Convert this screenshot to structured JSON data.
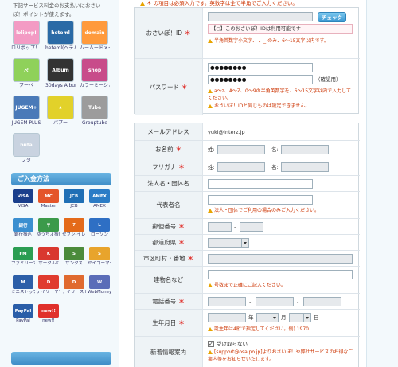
{
  "sidebar": {
    "note": "下記サービス料金のお支払いにおさいぽ！ポイントが使えます。",
    "services": [
      {
        "label": "ロリポップ！レンタルサーバー",
        "icon": "lolipop-icon",
        "color": "#f39bc4",
        "tile": "lolipop!"
      },
      {
        "label": "heteml(ヘテムル)",
        "icon": "heteml-icon",
        "color": "#2a6aa6",
        "tile": "heteml"
      },
      {
        "label": "ムームードメイン",
        "icon": "muumuu-domain-icon",
        "color": "#ff9a3c",
        "tile": "domain"
      },
      {
        "label": "ブーペ",
        "icon": "petit-icon",
        "color": "#8fd15a",
        "tile": "ペ"
      },
      {
        "label": "30days Album",
        "icon": "30days-album-icon",
        "color": "#333333",
        "tile": "Album"
      },
      {
        "label": "カラーミーショップ",
        "icon": "colorme-shop-icon",
        "color": "#c84c8a",
        "tile": "shop"
      },
      {
        "label": "JUGEM PLUS",
        "icon": "jugem-plus-icon",
        "color": "#4a7ab8",
        "tile": "JUGEM+"
      },
      {
        "label": "パプー",
        "icon": "papoo-icon",
        "color": "#e2d12a",
        "tile": "★"
      },
      {
        "label": "Grouptube",
        "icon": "grouptube-icon",
        "color": "#9c9c9c",
        "tile": "Tube"
      },
      {
        "label": "ブタ",
        "icon": "buta-icon",
        "color": "#c9d3e0",
        "tile": "buta"
      }
    ],
    "payment_heading": "ご入金方法",
    "payments": [
      {
        "label": "VISA",
        "icon": "visa-icon",
        "color": "#1a3f8c",
        "tile": "VISA"
      },
      {
        "label": "Master",
        "icon": "mastercard-icon",
        "color": "#e4552a",
        "tile": "MC"
      },
      {
        "label": "JCB",
        "icon": "jcb-icon",
        "color": "#1f6fb5",
        "tile": "JCB"
      },
      {
        "label": "AMEX",
        "icon": "amex-icon",
        "color": "#2b7cc6",
        "tile": "AMEX"
      },
      {
        "label": "銀行振込",
        "icon": "bank-transfer-icon",
        "color": "#3b8fd0",
        "tile": "銀行"
      },
      {
        "label": "ゆうちょ振替",
        "icon": "yucho-icon",
        "color": "#3b9a4a",
        "tile": "〒"
      },
      {
        "label": "セブン-イレブン",
        "icon": "seven-eleven-icon",
        "color": "#e46a1a",
        "tile": "7"
      },
      {
        "label": "ローソン",
        "icon": "lawson-icon",
        "color": "#2e6fc4",
        "tile": "L"
      },
      {
        "label": "ファミリーマート",
        "icon": "familymart-icon",
        "color": "#2a9d52",
        "tile": "FM"
      },
      {
        "label": "サークルK",
        "icon": "circle-k-icon",
        "color": "#d9382f",
        "tile": "K"
      },
      {
        "label": "サンクス",
        "icon": "sunkus-icon",
        "color": "#4b8b3b",
        "tile": "S"
      },
      {
        "label": "セイコーマート",
        "icon": "seicomart-icon",
        "color": "#e8a42c",
        "tile": "S"
      },
      {
        "label": "ミニストップ",
        "icon": "ministop-icon",
        "color": "#2c5fa8",
        "tile": "M"
      },
      {
        "label": "デイリーヤマザキ",
        "icon": "daily-yamazaki-icon",
        "color": "#e03c2f",
        "tile": "D"
      },
      {
        "label": "デイリーストア",
        "icon": "daily-store-icon",
        "color": "#e06a2f",
        "tile": "D"
      },
      {
        "label": "WebMoney",
        "icon": "webmoney-icon",
        "color": "#5a6db8",
        "tile": "W"
      },
      {
        "label": "PayPal",
        "icon": "paypal-icon",
        "color": "#2a5ea8",
        "tile": "PayPal"
      },
      {
        "label": "new!!",
        "icon": "new-badge-icon",
        "color": "#e0302b",
        "tile": "new!!"
      }
    ]
  },
  "form": {
    "top_notice": "＊ の項目は必須入力です。英数字は全て半角でご入力ください。",
    "required_mark": "＊",
    "id": {
      "label": "おさいぽ！ID",
      "check_button": "チェック",
      "info": "【○】このおさいぽ！IDは利用可能です",
      "note": "半角英数字小文字、-、_ のみ、6〜15文字以内です。"
    },
    "password": {
      "label": "パスワード",
      "value1": "●●●●●●●●",
      "value2": "●●●●●●●●",
      "confirm_label": "（確認用）",
      "note1": "a〜z、A〜Z、0〜9の半角英数字を、6〜15文字以内で入力してください。",
      "note2": "おさいぽ！IDと同じものは設定できません。"
    },
    "email": {
      "label": "メールアドレス",
      "value": "yuki@interz.jp"
    },
    "name": {
      "label": "お名前",
      "last": "姓:",
      "first": "名:"
    },
    "furigana": {
      "label": "フリガナ",
      "last": "姓:",
      "first": "名:"
    },
    "corp": {
      "label": "法人名・団体名"
    },
    "rep": {
      "label": "代表者名",
      "note": "法人・団体でご利用の場合のみご入力ください。"
    },
    "zip": {
      "label": "郵便番号",
      "sep": "-"
    },
    "pref": {
      "label": "都道府県"
    },
    "city": {
      "label": "市区町村・番地"
    },
    "building": {
      "label": "建物名など",
      "note": "号数まで正確にご記入ください。"
    },
    "phone": {
      "label": "電話番号",
      "sep1": "-",
      "sep2": "-"
    },
    "birthday": {
      "label": "生年月日",
      "year": "年",
      "month": "月",
      "day": "日",
      "note": "誕生年は4桁で指定してください。例) 1970"
    },
    "newsletter": {
      "label": "新着情報案内",
      "checkbox_label": "受け取らない",
      "checked": true,
      "note": "[support@osaipo.jp]よりおさいぽ！や弊社サービスのお得なご案内等をお知らせいたします。"
    }
  }
}
